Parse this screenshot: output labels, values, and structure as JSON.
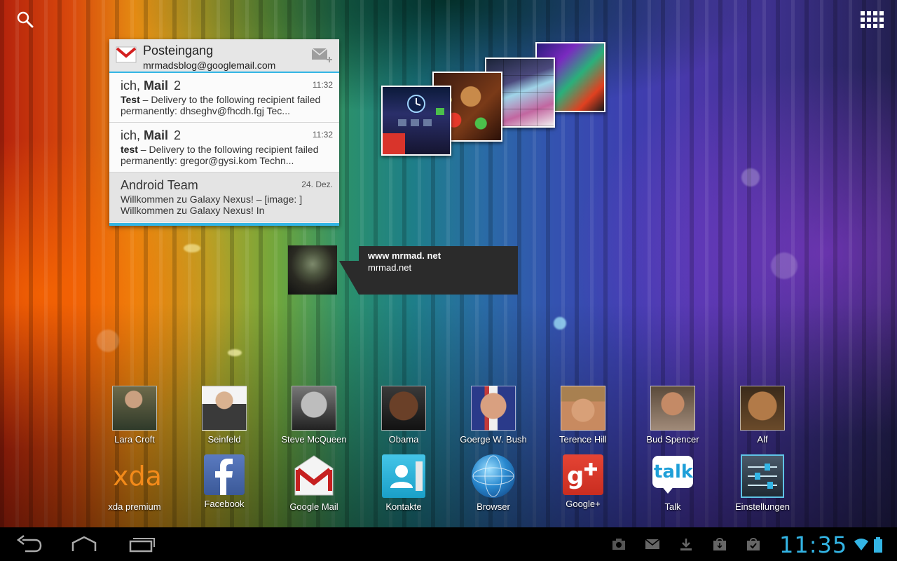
{
  "gmail_widget": {
    "title": "Posteingang",
    "account": "mrmadsblog@googlemail.com",
    "messages": [
      {
        "from": "ich,",
        "from_bold": "Mail",
        "count": "2",
        "time": "11:32",
        "subject": "Test",
        "snippet": " – Delivery to the following recipient failed",
        "snippet2": "permanently: dhseghv@fhcdh.fgj Tec..."
      },
      {
        "from": "ich,",
        "from_bold": "Mail",
        "count": "2",
        "time": "11:32",
        "subject": "test",
        "snippet": " – Delivery to the following recipient failed",
        "snippet2": "permanently: gregor@gysi.kom Techn..."
      },
      {
        "from": "Android Team",
        "from_bold": "",
        "count": "",
        "time": "24. Dez.",
        "subject": "",
        "snippet": "Willkommen zu Galaxy Nexus! – [image: ]",
        "snippet2": "Willkommen zu Galaxy Nexus! In"
      }
    ]
  },
  "contact_bubble": {
    "title": "www mrmad. net",
    "subtitle": "mrmad.net"
  },
  "contacts": [
    {
      "label": "Lara Croft"
    },
    {
      "label": "Seinfeld"
    },
    {
      "label": "Steve McQueen"
    },
    {
      "label": "Obama"
    },
    {
      "label": "Goerge W. Bush"
    },
    {
      "label": "Terence Hill"
    },
    {
      "label": "Bud Spencer"
    },
    {
      "label": "Alf"
    }
  ],
  "apps": [
    {
      "label": "xda premium",
      "icon": "xda-icon"
    },
    {
      "label": "Facebook",
      "icon": "facebook-icon"
    },
    {
      "label": "Google Mail",
      "icon": "gmail-icon"
    },
    {
      "label": "Kontakte",
      "icon": "contacts-icon"
    },
    {
      "label": "Browser",
      "icon": "globe-icon"
    },
    {
      "label": "Google+",
      "icon": "google-plus-icon"
    },
    {
      "label": "Talk",
      "icon": "talk-icon"
    },
    {
      "label": "Einstellungen",
      "icon": "settings-icon"
    }
  ],
  "xda_logo_text": "xda",
  "talk_icon_text": "talk",
  "status_bar": {
    "time": "11:35",
    "accent_color": "#33b5e5"
  }
}
